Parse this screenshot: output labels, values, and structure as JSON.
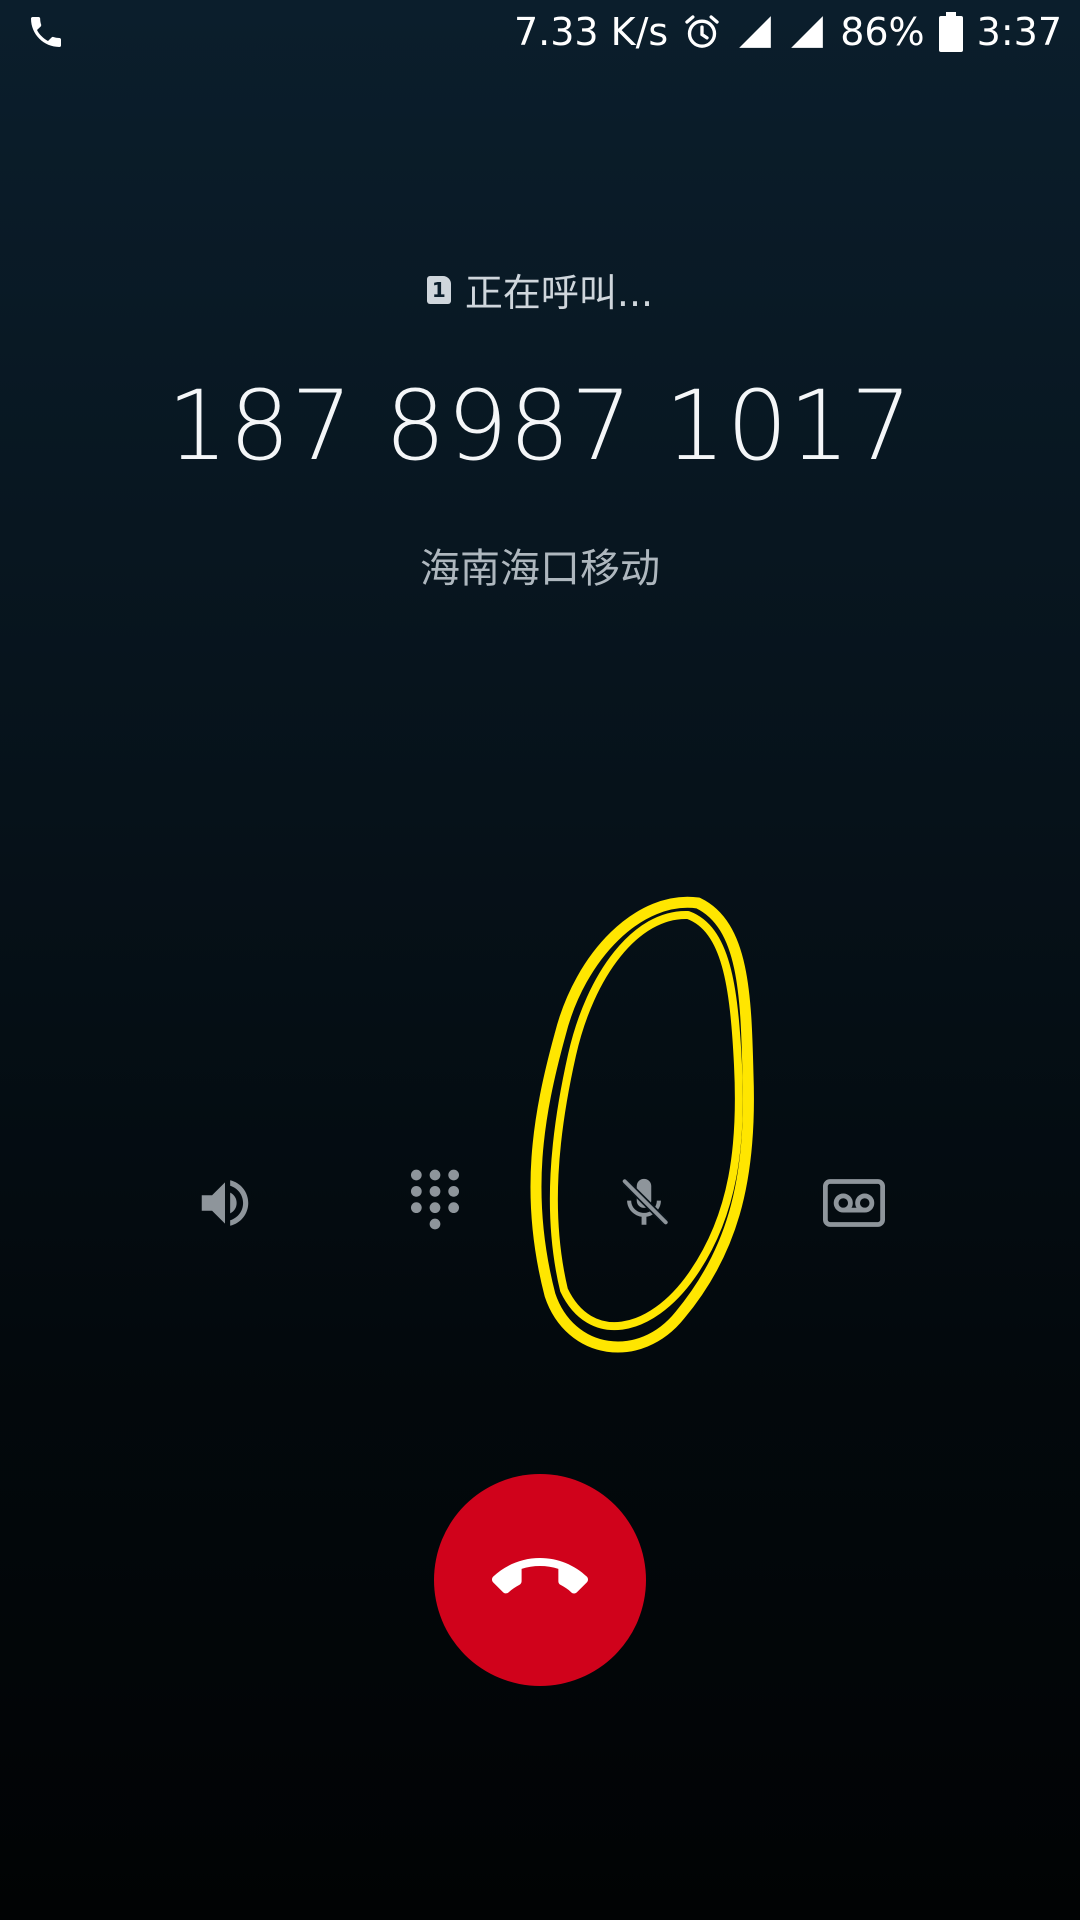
{
  "status_bar": {
    "net_speed": "7.33 K/s",
    "battery": "86%",
    "time": "3:37",
    "icons": [
      "phone-icon",
      "alarm-icon",
      "signal-icon",
      "signal-icon",
      "battery-icon"
    ]
  },
  "call": {
    "sim_slot": "1",
    "status": "正在呼叫...",
    "number": "187 8987 1017",
    "carrier": "海南海口移动"
  },
  "controls": {
    "items": [
      {
        "icon": "speaker-icon"
      },
      {
        "icon": "dialpad-icon"
      },
      {
        "icon": "mic-off-icon"
      },
      {
        "icon": "voicemail-record-icon"
      }
    ]
  },
  "end_call": {
    "icon": "end-call-icon",
    "color": "#d0021b"
  },
  "annotation": {
    "color": "#ffe600"
  }
}
